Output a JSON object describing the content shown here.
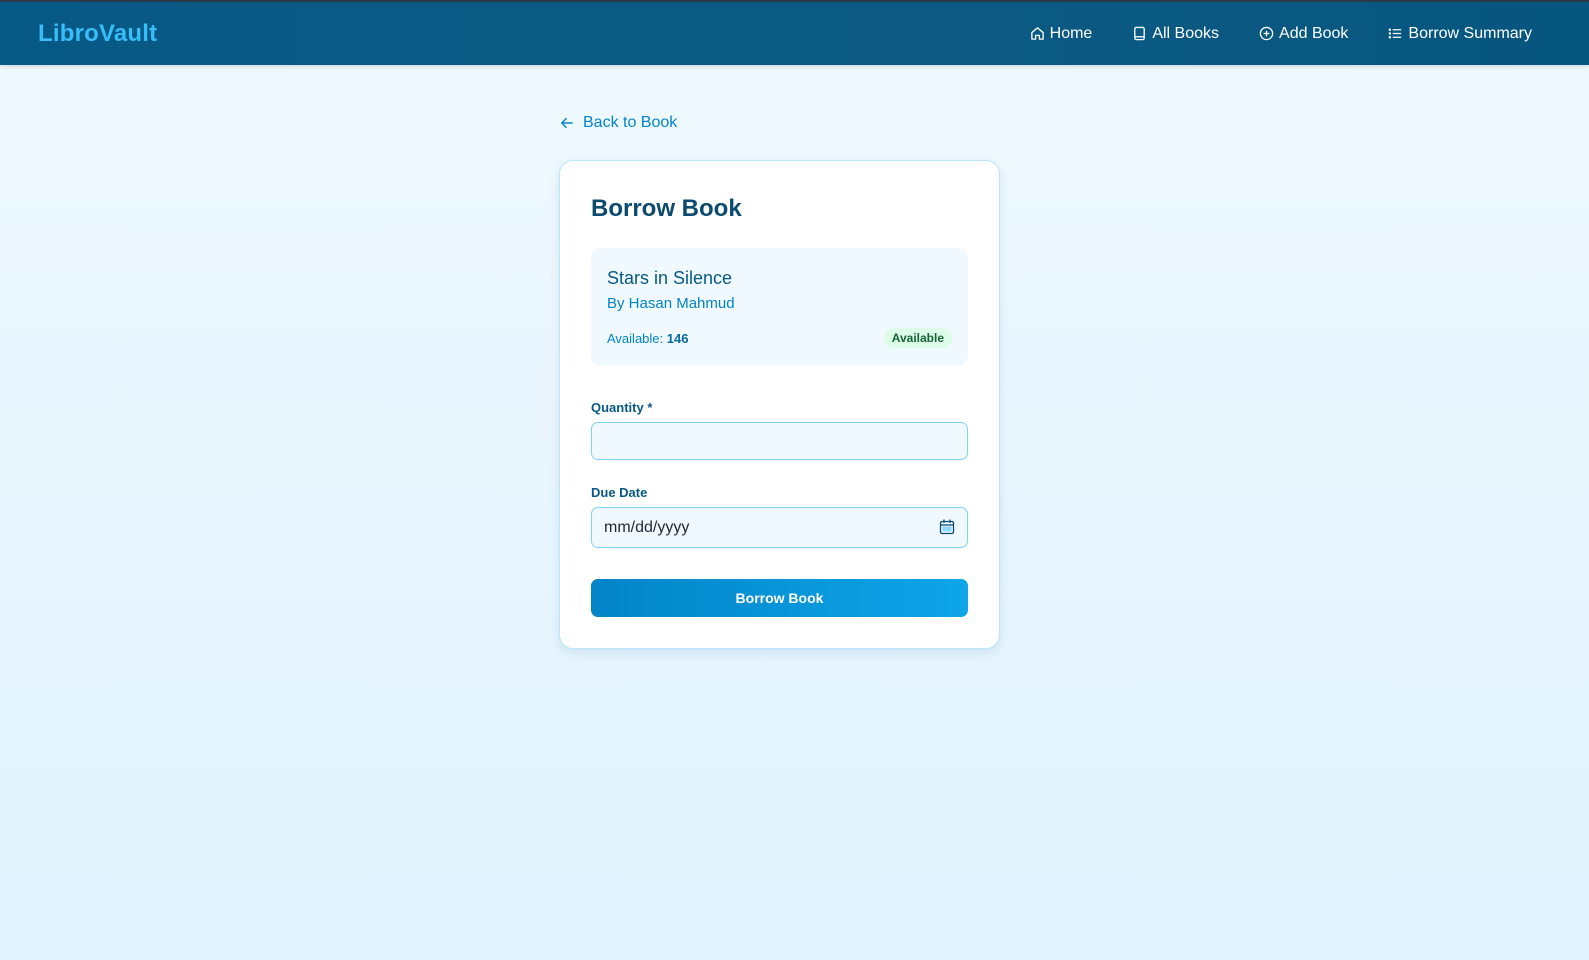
{
  "nav": {
    "brand": "LibroVault",
    "links": [
      {
        "label": "Home",
        "icon": "home-icon"
      },
      {
        "label": "All Books",
        "icon": "book-icon"
      },
      {
        "label": "Add Book",
        "icon": "plus-circle-icon"
      },
      {
        "label": "Borrow Summary",
        "icon": "list-icon"
      }
    ]
  },
  "back_link": {
    "label": "Back to Book",
    "icon": "arrow-left-icon"
  },
  "card": {
    "title": "Borrow Book",
    "book": {
      "title": "Stars in Silence",
      "author": "By Hasan Mahmud",
      "available_label": "Available: ",
      "available_count": "146",
      "status": "Available"
    },
    "quantity": {
      "label": "Quantity *",
      "value": ""
    },
    "due_date": {
      "label": "Due Date",
      "placeholder": "mm/dd/yyyy",
      "icon": "calendar-icon"
    },
    "submit_label": "Borrow Book"
  },
  "colors": {
    "nav_bg": "#075985",
    "brand": "#38bdf8",
    "accent": "#0284c7",
    "heading": "#0c4a6e",
    "badge_bg": "#dcfce7",
    "badge_text": "#166534"
  }
}
